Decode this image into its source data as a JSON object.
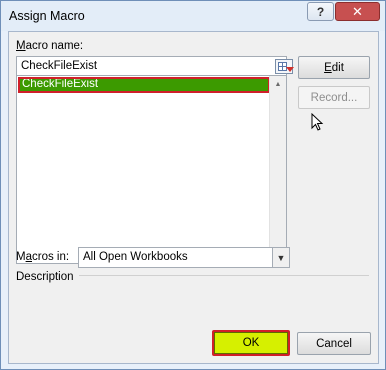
{
  "window": {
    "title": "Assign Macro",
    "help_glyph": "?",
    "close_glyph": "✕"
  },
  "macro_name": {
    "label_underlined": "M",
    "label_rest": "acro name:",
    "value": "CheckFileExist"
  },
  "macro_list": {
    "items": [
      "CheckFileExist"
    ],
    "selected_index": 0,
    "selection_color": "#3c9a00",
    "highlight_border": "#d0202a"
  },
  "macros_in": {
    "label_pre": "M",
    "label_underlined": "a",
    "label_rest": "cros in:",
    "selected": "All Open Workbooks"
  },
  "description": {
    "label": "Description"
  },
  "buttons": {
    "edit_underlined": "E",
    "edit_rest": "dit",
    "record": "Record...",
    "ok": "OK",
    "cancel": "Cancel"
  },
  "colors": {
    "ok_fill": "#d6f000",
    "close_fill": "#c75050"
  }
}
